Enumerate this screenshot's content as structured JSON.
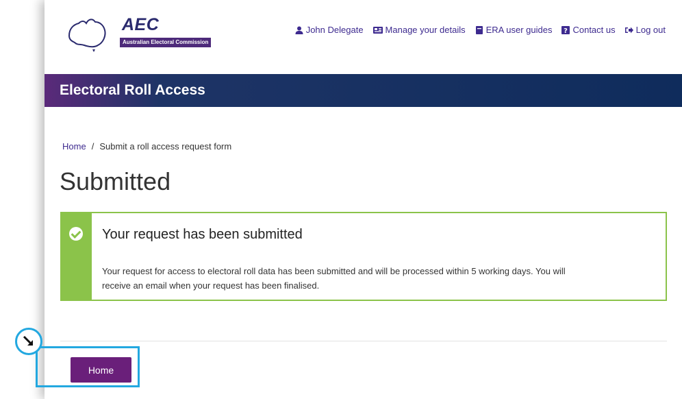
{
  "logo": {
    "acronym": "AEC",
    "subtitle": "Australian Electoral Commission"
  },
  "usernav": {
    "user_name": "John Delegate",
    "manage_label": "Manage your details",
    "guides_label": "ERA user guides",
    "contact_label": "Contact us",
    "logout_label": "Log out"
  },
  "banner": {
    "title": "Electoral Roll Access"
  },
  "breadcrumb": {
    "home": "Home",
    "separator": "/",
    "current": "Submit a roll access request form"
  },
  "page": {
    "title": "Submitted"
  },
  "alert": {
    "heading": "Your request has been submitted",
    "body": "Your request for access to electoral roll data has been submitted and will be processed within 5 working days. You will receive an email when your request has been finalised."
  },
  "actions": {
    "home_button": "Home"
  },
  "colors": {
    "brand_purple": "#6a1f7a",
    "banner_navy": "#0f2c5c",
    "success_green": "#8bc34a",
    "link": "#3d2a8f",
    "annotation_blue": "#23a8e0"
  },
  "icons": {
    "user": "user-icon",
    "manage": "id-card-icon",
    "guides": "book-icon",
    "contact": "question-icon",
    "logout": "sign-out-icon",
    "check": "check-circle-icon",
    "annotation": "arrow-down-right-icon"
  }
}
